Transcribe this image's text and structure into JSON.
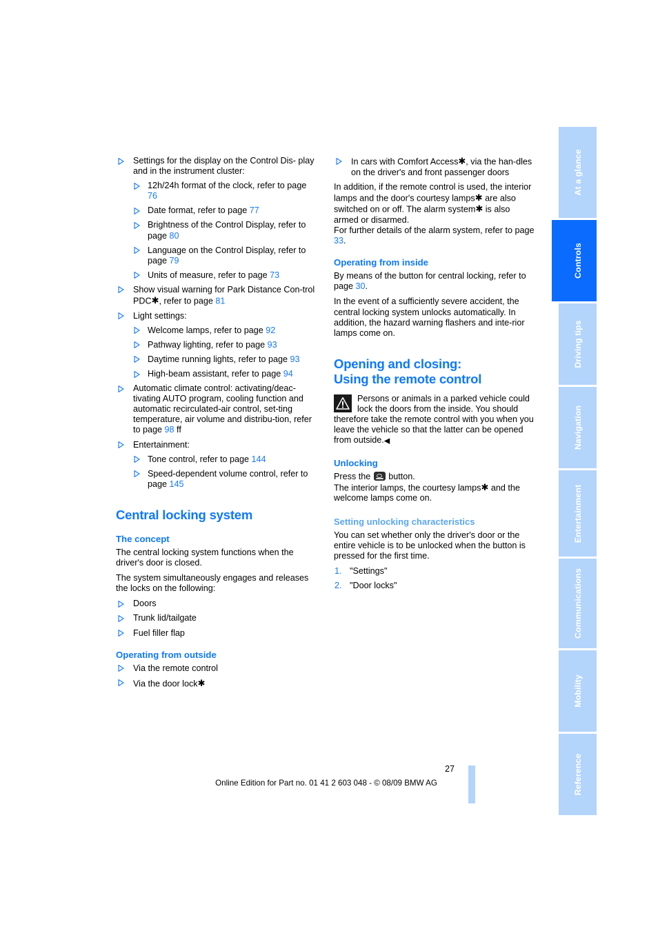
{
  "document": {
    "page_number": "27",
    "footer_text": "Online Edition for Part no. 01 41 2 603 048 - © 08/09 BMW AG",
    "accent_blue": "#1478ff",
    "heading_blue": "#0d78ff",
    "subheading_light_blue": "#5aa6f5",
    "tab_inactive_bg": "#b3d4fb",
    "tab_active_bg": "#0b6bff"
  },
  "tabs": [
    {
      "label": "At a glance",
      "active": false
    },
    {
      "label": "Controls",
      "active": true
    },
    {
      "label": "Driving tips",
      "active": false
    },
    {
      "label": "Navigation",
      "active": false
    },
    {
      "label": "Entertainment",
      "active": false
    },
    {
      "label": "Communications",
      "active": false
    },
    {
      "label": "Mobility",
      "active": false
    },
    {
      "label": "Reference",
      "active": false
    }
  ],
  "left_column": {
    "b1": "Settings for the display on the Control Dis-play and in the instrument cluster:",
    "b1_text_a": "Settings for the display on the Control Dis-",
    "b1_text_b": "play and in the instrument cluster:",
    "b1_sub": [
      {
        "text": "12h/24h format of the clock, refer to page ",
        "page": "76"
      },
      {
        "text": "Date format, refer to page ",
        "page": "77"
      },
      {
        "text": "Brightness of the Control Display, refer to page ",
        "page": "80"
      },
      {
        "text": "Language on the Control Display, refer to page ",
        "page": "79"
      },
      {
        "text": "Units of measure, refer to page ",
        "page": "73"
      }
    ],
    "b2_pre": "Show visual warning for Park Distance Con-trol PDC",
    "b2_post": ", refer to page ",
    "b2_page": "81",
    "b3": "Light settings:",
    "b3_sub": [
      {
        "text": "Welcome lamps, refer to page ",
        "page": "92"
      },
      {
        "text": "Pathway lighting, refer to page ",
        "page": "93"
      },
      {
        "text": "Daytime running lights, refer to page ",
        "page": "93"
      },
      {
        "text": "High-beam assistant, refer to page ",
        "page": "94"
      }
    ],
    "b4_text": "Automatic climate control: activating/deac-tivating AUTO program, cooling function and automatic recirculated-air control, set-ting temperature, air volume and distribu-tion, refer to page ",
    "b4_page": "98",
    "b4_suffix": " ff",
    "b5": "Entertainment:",
    "b5_sub": [
      {
        "text": "Tone control, refer to page ",
        "page": "144"
      },
      {
        "text": "Speed-dependent volume control, refer to page ",
        "page": "145"
      }
    ],
    "heading_central_locking": "Central locking system",
    "sub_concept": "The concept",
    "concept_p1": "The central locking system functions when the driver's door is closed.",
    "concept_p2": "The system simultaneously engages and releases the locks on the following:",
    "concept_items": [
      "Doors",
      "Trunk lid/tailgate",
      "Fuel filler flap"
    ],
    "sub_operating_outside": "Operating from outside",
    "outside_items": [
      {
        "text": "Via the remote control",
        "star": false
      },
      {
        "text": "Via the door lock",
        "star": true
      }
    ]
  },
  "right_column": {
    "b1_pre": "In cars with Comfort Access",
    "b1_post": ", via the han-dles on the driver's and front passenger doors",
    "p1_a": "In addition, if the remote control is used, the interior lamps and the door's courtesy lamps",
    "p1_b": "are also switched on or off. The alarm system",
    "p1_c": "is also armed or disarmed.",
    "p2_pre": "For further details of the alarm system, refer to page ",
    "p2_page": "33",
    "p2_post": ".",
    "sub_operating_inside": "Operating from inside",
    "inside_p1_pre": "By means of the button for central locking, refer to page ",
    "inside_p1_page": "30",
    "inside_p1_post": ".",
    "inside_p2": "In the event of a sufficiently severe accident, the central locking system unlocks automatically. In addition, the hazard warning flashers and inte-rior lamps come on.",
    "heading_opening_line1": "Opening and closing:",
    "heading_opening_line2": "Using the remote control",
    "warning_text": "Persons or animals in a parked vehicle could lock the doors from the inside. You should therefore take the remote control with you when you leave the vehicle so that the latter can be opened from outside.",
    "warning_endmark": "◀",
    "warning_icon": "warning-triangle-icon",
    "sub_unlocking": "Unlocking",
    "unlock_press_pre": "Press the ",
    "unlock_button_icon": "unlock-remote-button-icon",
    "unlock_press_post": " button.",
    "unlock_p2_a": "The interior lamps, the courtesy lamps",
    "unlock_p2_b": " and the welcome lamps come on.",
    "sub_setting_unlocking": "Setting unlocking characteristics",
    "setting_p1": "You can set whether only the driver's door or the entire vehicle is to be unlocked when the button is pressed for the first time.",
    "steps": [
      {
        "num": "1.",
        "label": "\"Settings\""
      },
      {
        "num": "2.",
        "label": "\"Door locks\""
      }
    ]
  },
  "symbols": {
    "bullet_triangle": "▷",
    "asterisk": "✱"
  }
}
